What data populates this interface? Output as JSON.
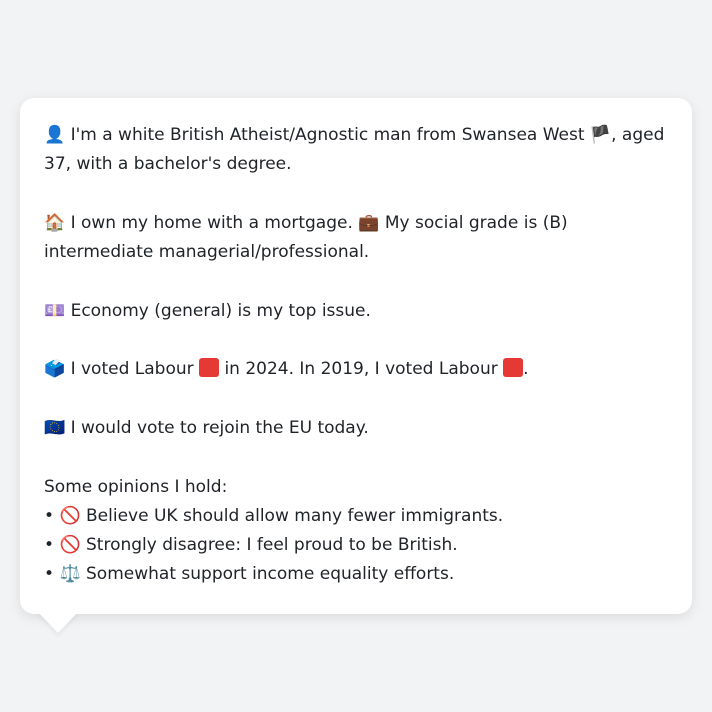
{
  "profile": {
    "line1": {
      "icon": "👤",
      "text_a": "I'm a white British Atheist/Agnostic man from Swansea West",
      "flag": "🏴",
      "text_b": ", aged 37, with a bachelor's degree."
    },
    "line2": {
      "icon_home": "🏠",
      "text_a": "I own my home with a mortgage.",
      "icon_briefcase": "💼",
      "text_b": "My social grade is (B) intermediate managerial/professional."
    },
    "line3": {
      "icon": "💷",
      "text": "Economy (general) is my top issue."
    },
    "line4": {
      "icon": "🗳️",
      "text_a": "I voted Labour",
      "text_b": "in 2024. In 2019, I voted Labour",
      "text_c": ".",
      "party_color": "#e53935"
    },
    "line5": {
      "icon": "🇪🇺",
      "text": "I would vote to rejoin the EU today."
    },
    "opinions": {
      "heading": "Some opinions I hold:",
      "items": [
        {
          "bullet": "•",
          "icon": "🚫",
          "text": "Believe UK should allow many fewer immigrants."
        },
        {
          "bullet": "•",
          "icon": "🚫",
          "text": "Strongly disagree: I feel proud to be British."
        },
        {
          "bullet": "•",
          "icon": "⚖️",
          "text": "Somewhat support income equality efforts."
        }
      ]
    }
  }
}
